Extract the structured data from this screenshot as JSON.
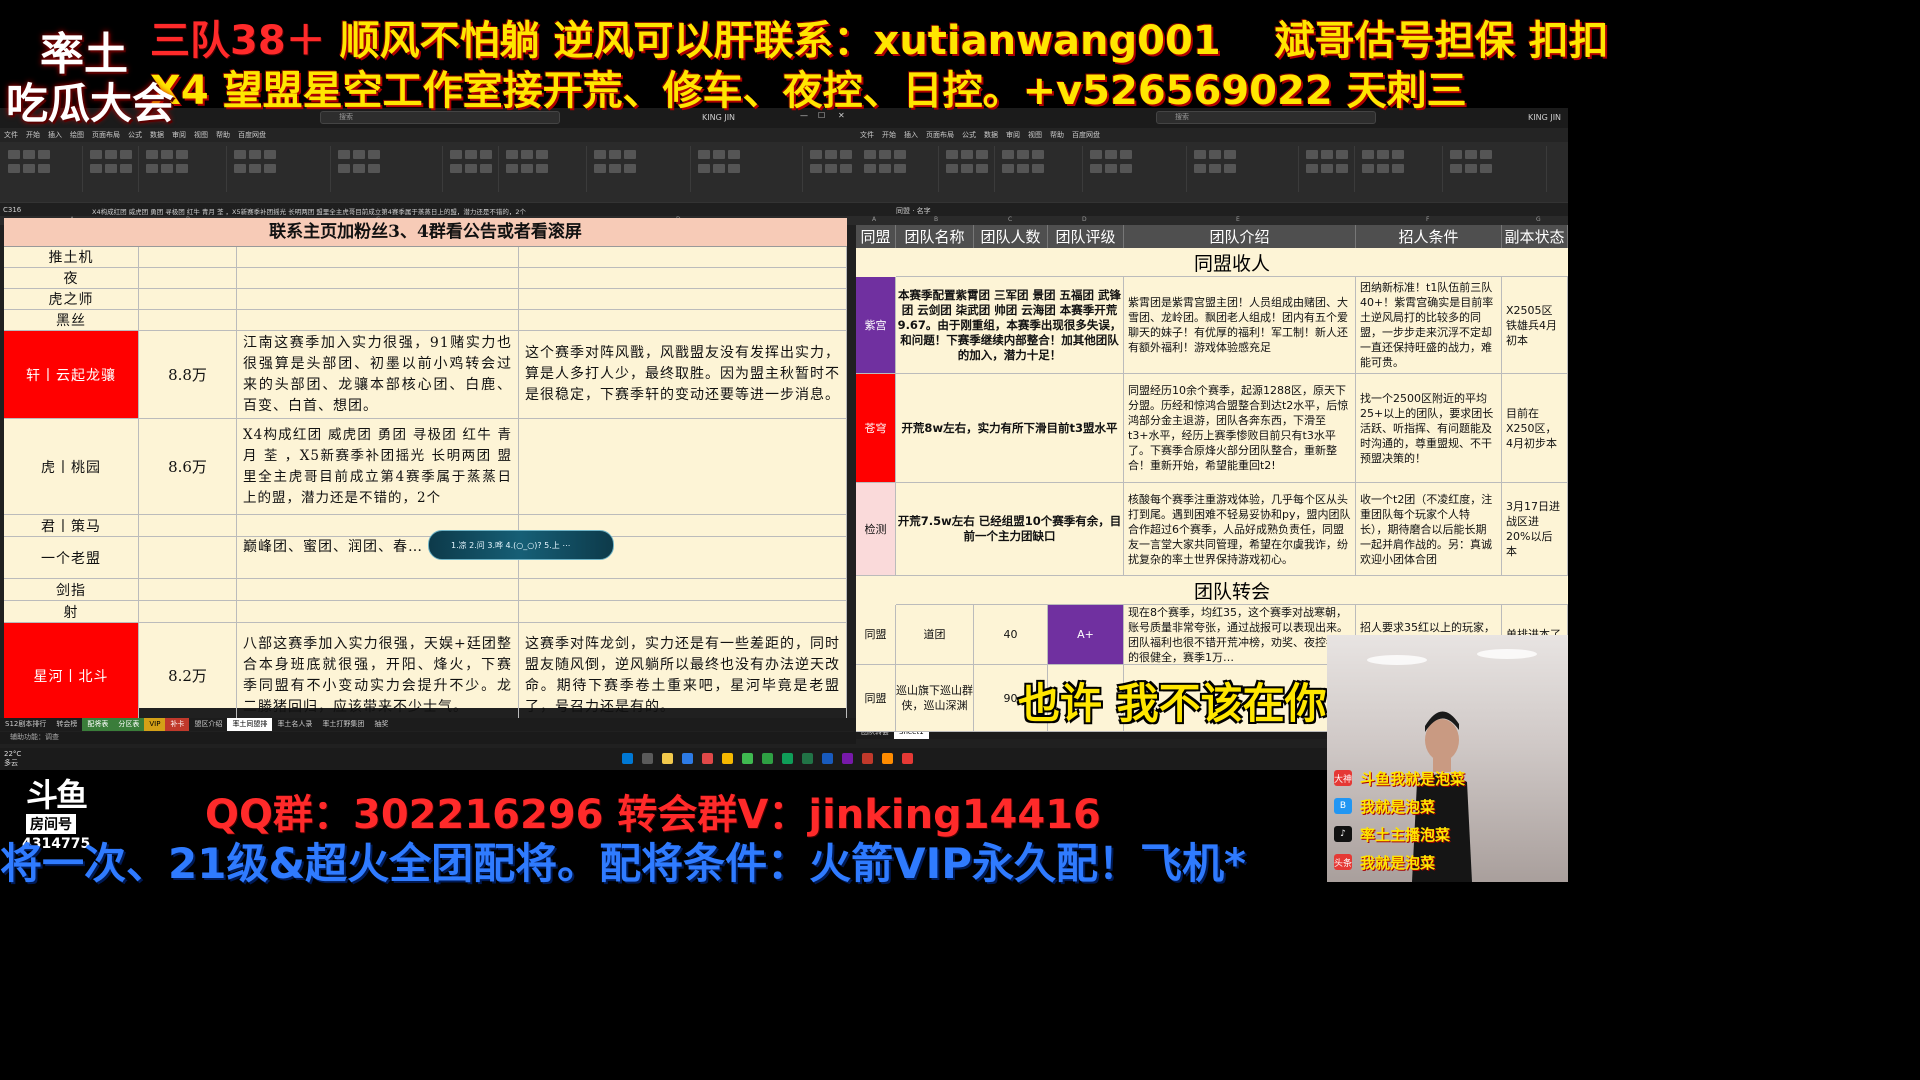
{
  "banner": {
    "line1_prefix": "三队38＋",
    "line1_main": "  顺风不怕躺 逆风可以肝联系：xutianwang001",
    "line1_right": "斌哥估号担保 扣扣",
    "line2": "X4   望盟星空工作室接开荒、修车、夜控、日控。+v526569022   天刺三"
  },
  "logo": {
    "line1": "率土",
    "line2": "吃瓜大会"
  },
  "left_window": {
    "search": "搜索",
    "user": "KING JIN",
    "menu": [
      "文件",
      "开始",
      "插入",
      "绘图",
      "页面布局",
      "公式",
      "数据",
      "审阅",
      "视图",
      "帮助",
      "百度网盘"
    ],
    "namebox": "C316",
    "formula": "X4构成红团  威虎团  勇团  寻极团  红牛  青月  荃 ，X5新赛季补团摇光  长明两团   盟里全主虎哥目前成立第4赛季属于蒸蒸日上的盟，潜力还是不错的，2个",
    "col_headers": [
      "A",
      "B",
      "C",
      "D"
    ],
    "sheet": {
      "title": "联系主页加粉丝3、4群看公告或者看滚屏",
      "rows": [
        {
          "name": "推土机"
        },
        {
          "name": "夜"
        },
        {
          "name": "虎之师"
        },
        {
          "name": "黑丝"
        },
        {
          "name": "轩丨云起龙骧",
          "value": "8.8万",
          "c": "江南这赛季加入实力很强，91赌实力也很强算是头部团、初墨以前小鸡转会过来的头部团、龙骧本部核心团、白鹿、百变、白首、想团。",
          "d": "这个赛季对阵风戬，风戬盟友没有发挥出实力，算是人多打人少，最终取胜。因为盟主秋暂时不是很稳定，下赛季轩的变动还要等进一步消息。"
        },
        {
          "name": "虎丨桃园",
          "value": "8.6万",
          "c": "X4构成红团  威虎团  勇团  寻极团  红牛  青月  荃 ，X5新赛季补团摇光  长明两团   盟里全主虎哥目前成立第4赛季属于蒸蒸日上的盟，潜力还是不错的，2个"
        },
        {
          "name": "君丨策马"
        },
        {
          "name": "一个老盟",
          "c": "巅峰团、蜜团、润团、春…  猎魂团"
        },
        {
          "name": "剑指"
        },
        {
          "name": "射"
        },
        {
          "name": "星河丨北斗",
          "value": "8.2万",
          "c": "八部这赛季加入实力很强，天娱+廷团整合本身班底就很强，开阳、烽火，下赛季同盟有不小变动实力会提升不少。龙二滕猪回归，应该带来不少士气。",
          "d": "这赛季对阵龙剑，实力还是有一些差距的，同时盟友随风倒，逆风躺所以最终也没有办法逆天改命。期待下赛季卷土重来吧，星河毕竟是老盟了，号召力还是有的。"
        }
      ]
    },
    "tabs": [
      "S12剧本排行",
      "转会榜",
      "配将表",
      "分区表",
      "VIP",
      "补卡",
      "盟区介绍",
      "率土同盟排",
      "率土名人录",
      "率土打野集团",
      "抽奖"
    ],
    "status": "辅助功能：调查",
    "weather": {
      "temp": "22°C",
      "desc": "多云"
    }
  },
  "popup": {
    "text": "1.凉 2.问 3.哗 4.(○_○)? 5.上 ⋯"
  },
  "right_window": {
    "search": "搜索",
    "user": "KING JIN",
    "menu": [
      "文件",
      "开始",
      "插入",
      "页面布局",
      "公式",
      "数据",
      "审阅",
      "视图",
      "帮助",
      "百度网盘"
    ],
    "formula": "同盟 · 名字",
    "col_headers": [
      "A",
      "B",
      "C",
      "D",
      "E",
      "F",
      "G"
    ],
    "headers": [
      "同盟",
      "团队名称",
      "团队人数",
      "团队评级",
      "团队介绍",
      "招人条件",
      "副本状态"
    ],
    "section1": "同盟收人",
    "section2": "团队转会",
    "rows": [
      {
        "alliance": "紫宫",
        "desc": "本赛季配置紫霄团 三军团 景团 五福团 武锋团 云剑团 柒武团 帅团 云海团 本赛季开荒9.67。由于刚重组，本赛季出现很多失误，和问题！下赛季继续内部整合！加其他团队的加入，潜力十足！",
        "intro": "紫霄团是紫霄宫盟主团！人员组成由赌团、大雪团、龙岭团。飘团老人组成！团内有五个爱聊天的妹子！有优厚的福利！军工制！新人还有额外福利！游戏体验感充足",
        "cond": "团纳新标准！t1队伍前三队40+！紫霄宫确实是目前率土逆风局打的比较多的同盟，一步步走来沉浮不定却一直还保持旺盛的战力，难能可贵。",
        "status": "X2505区铁雄兵4月初本"
      },
      {
        "alliance": "苍穹",
        "desc": "开荒8w左右，实力有所下滑目前t3盟水平",
        "intro": "同盟经历10余个赛季，起源1288区，原天下分盟。历经和惊鸿合盟整合到达t2水平，后惊鸿部分金主退游，团队各奔东西，下滑至t3+水平，经历上赛季惨败目前只有t3水平了。下赛季合原烽火部分团队整合，重新整合！重新开始，希望能重回t2!",
        "cond": "找一个2500区附近的平均25+以上的团队，要求团长活跃、听指挥、有问题能及时沟通的，尊重盟规、不干预盟决策的！",
        "status": "目前在X250区，4月初步本"
      },
      {
        "alliance": "检测",
        "desc": "开荒7.5w左右 已经组盟10个赛季有余，目前一个主力团缺口",
        "intro": "核酸每个赛季注重游戏体验，几乎每个区从头打到尾。遇到困难不轻易妥协和py，盟内团队合作超过6个赛季，人品好成熟负责任，同盟友一言堂大家共同管理，希望在尔虞我诈，纷扰复杂的率土世界保持游戏初心。",
        "cond": "收一个t2团（不凌红度，注重团队每个玩家个人特长），期待磨合以后能长期一起并肩作战的。另：真诚欢迎小团体合团",
        "status": "3月17日进战区进20%以后本"
      },
      {
        "alliance": "同盟",
        "team": "道团",
        "count": "40",
        "grade": "A+",
        "intro": "现在8个赛季，均红35，这个赛季对战寒朝，账号质量非常夸张，通过战报可以表现出来。团队福利也很不错开荒冲榜，劝奖、夜控都有的很健全，赛季1万…",
        "cond": "招人要求35红以上的玩家，建议高战高活跃玩家",
        "status": "单排进本了"
      },
      {
        "alliance": "同盟",
        "team": "巡山旗下巡山群侠，巡山深渊",
        "count": "90"
      }
    ],
    "tabs": [
      "团队转会",
      "Sheet1"
    ]
  },
  "subtitle": "也许 我不该在你",
  "bottom": {
    "platform": "斗鱼",
    "room_label": "房间号",
    "room_id": "4314775",
    "qq": "QQ群：302216296     转会群V：jinking14416",
    "line": "将一次、21级&超火全团配将。配将条件：火箭VIP永久配！飞机*"
  },
  "socials": [
    {
      "icon": "大神",
      "color": "#e53935",
      "text": "斗鱼我就是泡菜"
    },
    {
      "icon": "B",
      "color": "#2196f3",
      "text": "我就是泡菜"
    },
    {
      "icon": "♪",
      "color": "#111111",
      "text": "率土主播泡菜"
    },
    {
      "icon": "头条",
      "color": "#e53935",
      "text": "我就是泡菜"
    }
  ]
}
